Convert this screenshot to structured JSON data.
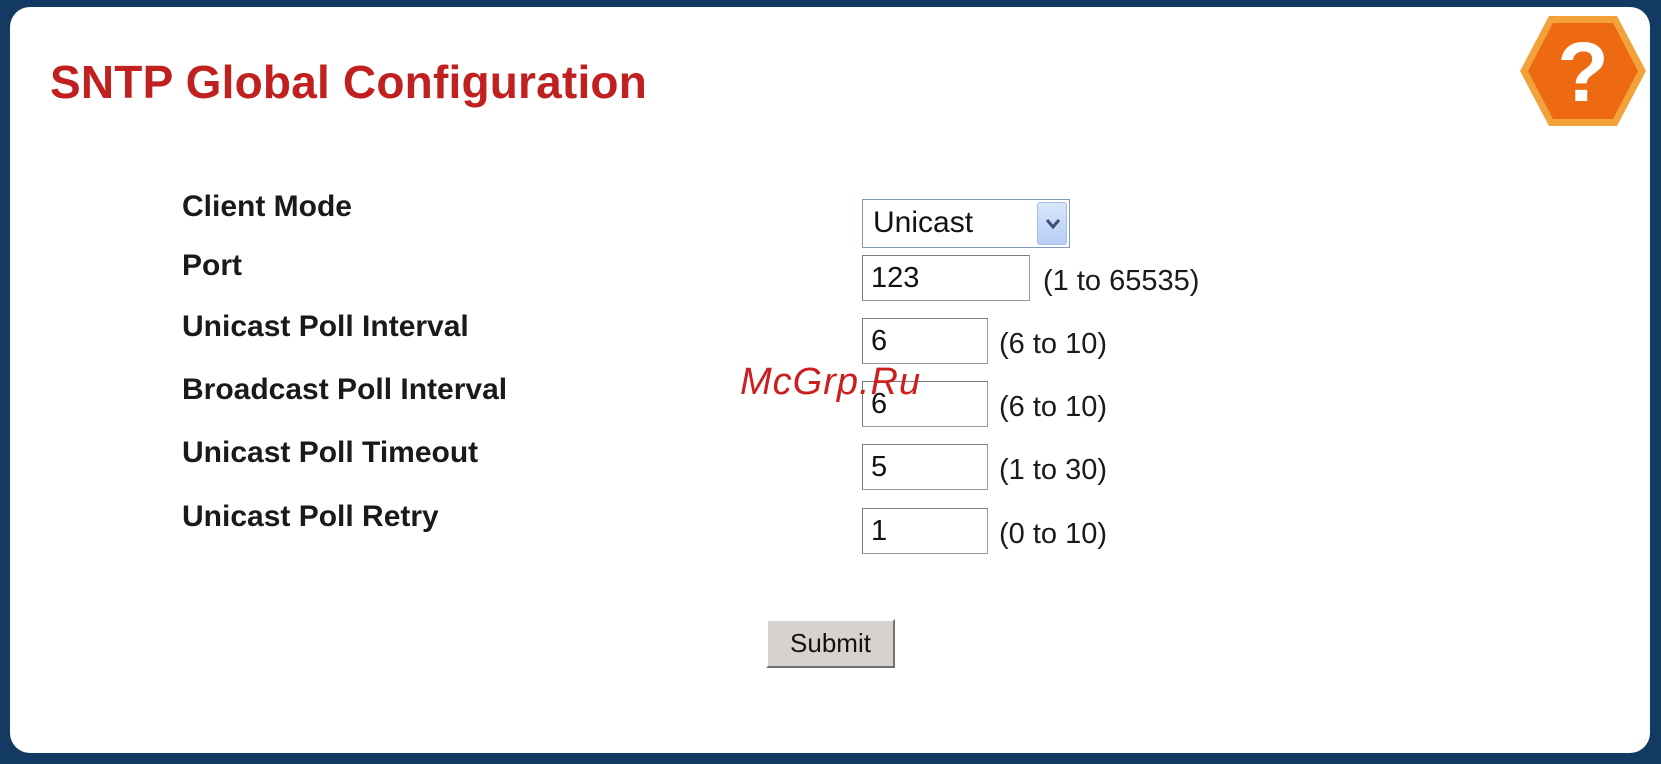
{
  "page": {
    "title": "SNTP Global Configuration"
  },
  "help": {
    "icon": "help-question-icon",
    "symbol": "?",
    "color": "#f07b18"
  },
  "form": {
    "client_mode": {
      "label": "Client Mode",
      "selected": "Unicast"
    },
    "port": {
      "label": "Port",
      "value": "123",
      "range": "(1 to 65535)"
    },
    "unicast_poll_interval": {
      "label": "Unicast Poll Interval",
      "value": "6",
      "range": "(6 to 10)"
    },
    "broadcast_poll_interval": {
      "label": "Broadcast Poll Interval",
      "value": "6",
      "range": "(6 to 10)"
    },
    "unicast_poll_timeout": {
      "label": "Unicast Poll Timeout",
      "value": "5",
      "range": "(1 to 30)"
    },
    "unicast_poll_retry": {
      "label": "Unicast Poll Retry",
      "value": "1",
      "range": "(0 to 10)"
    },
    "submit_label": "Submit"
  },
  "watermark": {
    "text": "McGrp.Ru"
  },
  "colors": {
    "frame": "#123a63",
    "title": "#c0201f",
    "help": "#f07b18"
  }
}
